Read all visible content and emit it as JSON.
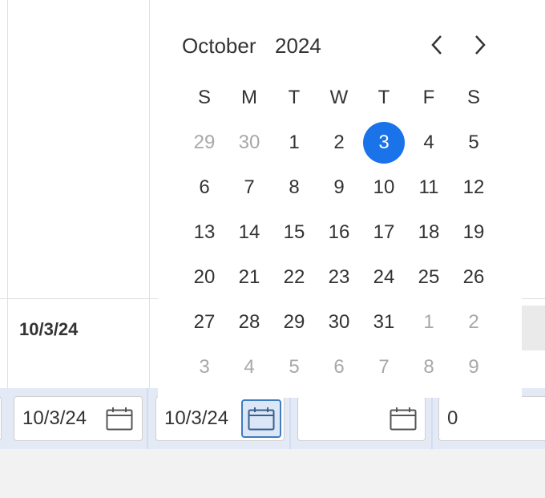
{
  "table": {
    "row_date_value": "10/3/24"
  },
  "filters": {
    "date_filter_1": "10/3/24",
    "date_filter_2": "10/3/24",
    "date_filter_3": "",
    "number_filter": "0"
  },
  "calendar": {
    "month": "October",
    "year": "2024",
    "prev_icon": "chevron-left-icon",
    "next_icon": "chevron-right-icon",
    "weekdays": [
      "S",
      "M",
      "T",
      "W",
      "T",
      "F",
      "S"
    ],
    "weeks": [
      [
        {
          "d": "29",
          "muted": true
        },
        {
          "d": "30",
          "muted": true
        },
        {
          "d": "1"
        },
        {
          "d": "2"
        },
        {
          "d": "3",
          "selected": true
        },
        {
          "d": "4"
        },
        {
          "d": "5"
        }
      ],
      [
        {
          "d": "6"
        },
        {
          "d": "7"
        },
        {
          "d": "8"
        },
        {
          "d": "9"
        },
        {
          "d": "10"
        },
        {
          "d": "11"
        },
        {
          "d": "12"
        }
      ],
      [
        {
          "d": "13"
        },
        {
          "d": "14"
        },
        {
          "d": "15"
        },
        {
          "d": "16"
        },
        {
          "d": "17"
        },
        {
          "d": "18"
        },
        {
          "d": "19"
        }
      ],
      [
        {
          "d": "20"
        },
        {
          "d": "21"
        },
        {
          "d": "22"
        },
        {
          "d": "23"
        },
        {
          "d": "24"
        },
        {
          "d": "25"
        },
        {
          "d": "26"
        }
      ],
      [
        {
          "d": "27"
        },
        {
          "d": "28"
        },
        {
          "d": "29"
        },
        {
          "d": "30"
        },
        {
          "d": "31"
        },
        {
          "d": "1",
          "muted": true
        },
        {
          "d": "2",
          "muted": true
        }
      ],
      [
        {
          "d": "3",
          "muted": true
        },
        {
          "d": "4",
          "muted": true
        },
        {
          "d": "5",
          "muted": true
        },
        {
          "d": "6",
          "muted": true
        },
        {
          "d": "7",
          "muted": true
        },
        {
          "d": "8",
          "muted": true
        },
        {
          "d": "9",
          "muted": true
        }
      ]
    ]
  },
  "colors": {
    "selected": "#1a73e8",
    "muted_text": "#a8a8a8",
    "filter_row_bg": "#e3eaf6",
    "active_button_border": "#3f7cc0"
  }
}
